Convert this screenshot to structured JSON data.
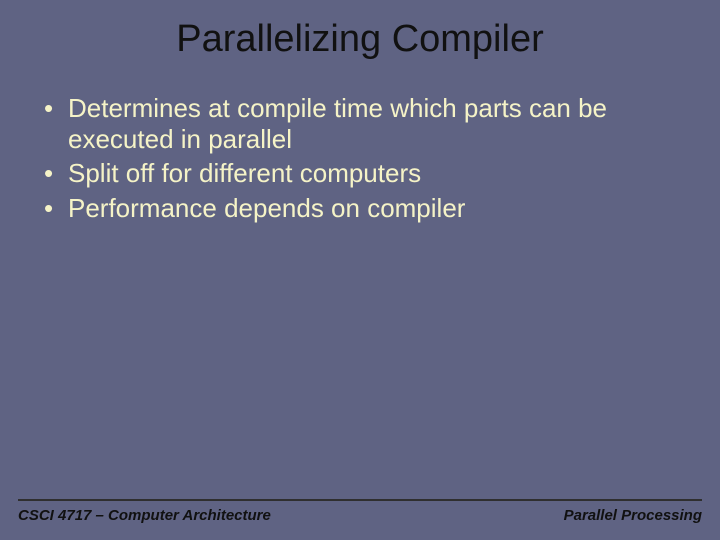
{
  "title": "Parallelizing Compiler",
  "bullets": [
    "Determines at compile time which parts can be executed in parallel",
    "Split off for different computers",
    "Performance depends on compiler"
  ],
  "footer": {
    "left": "CSCI 4717 – Computer Architecture",
    "right": "Parallel Processing"
  }
}
